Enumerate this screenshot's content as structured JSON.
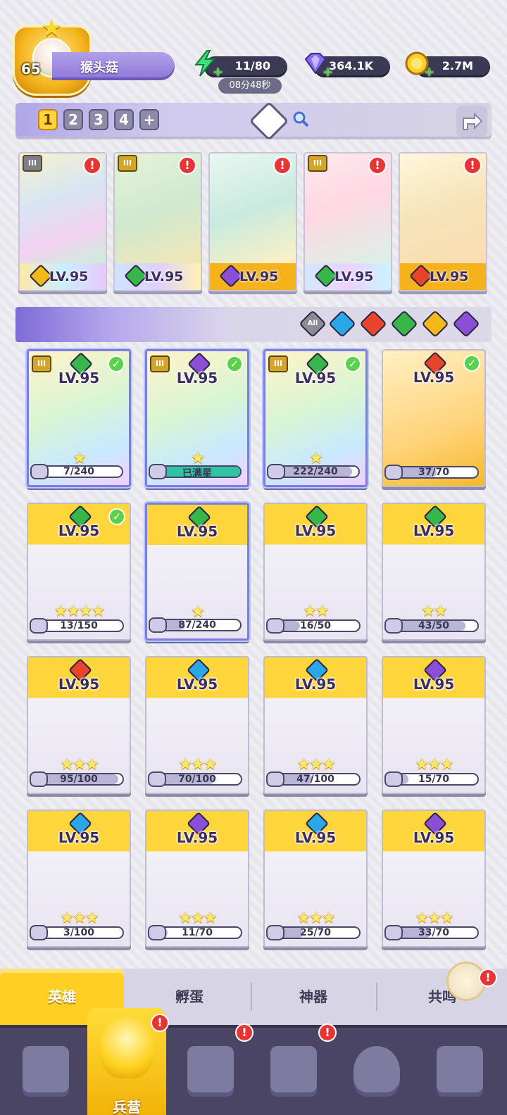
{
  "player": {
    "level": "65",
    "name": "猴头菇"
  },
  "resources": {
    "energy": "11/80",
    "energy_timer": "08分48秒",
    "gems": "364.1K",
    "coins": "2.7M"
  },
  "team_tabs": [
    "1",
    "2",
    "3",
    "4",
    "+"
  ],
  "team_add_label": "+",
  "team": [
    {
      "level": "LV.95",
      "element": "light",
      "tier": "III",
      "alert": "!"
    },
    {
      "level": "LV.95",
      "element": "nature",
      "tier": "III",
      "alert": "!"
    },
    {
      "level": "LV.95",
      "element": "dark",
      "alert": "!"
    },
    {
      "level": "LV.95",
      "element": "nature",
      "tier": "III",
      "alert": "!"
    },
    {
      "level": "LV.95",
      "element": "fire",
      "alert": "!"
    }
  ],
  "filters": {
    "all_label": "All",
    "elements": [
      "water",
      "fire",
      "nature",
      "light",
      "dark"
    ]
  },
  "heroes": [
    {
      "level": "LV.95",
      "element": "nature",
      "tier": "III",
      "check": "✓",
      "stars": "★",
      "progress_label": "7/240",
      "progress": 0.03
    },
    {
      "level": "LV.95",
      "element": "dark",
      "tier": "III",
      "check": "✓",
      "stars": "★",
      "progress_label": "已满星",
      "progress": 1
    },
    {
      "level": "LV.95",
      "element": "nature",
      "tier": "III",
      "check": "✓",
      "stars": "★",
      "progress_label": "222/240",
      "progress": 0.93
    },
    {
      "level": "LV.95",
      "element": "fire",
      "check": "✓",
      "stars": "",
      "progress_label": "37/70",
      "progress": 0.53
    },
    {
      "level": "LV.95",
      "element": "nature",
      "check": "✓",
      "stars": "★★★★",
      "progress_label": "13/150",
      "progress": 0.09
    },
    {
      "level": "LV.95",
      "element": "nature",
      "stars": "★",
      "progress_label": "87/240",
      "progress": 0.36
    },
    {
      "level": "LV.95",
      "element": "nature",
      "stars": "★★",
      "progress_label": "16/50",
      "progress": 0.32
    },
    {
      "level": "LV.95",
      "element": "nature",
      "stars": "★★",
      "progress_label": "43/50",
      "progress": 0.86
    },
    {
      "level": "LV.95",
      "element": "fire",
      "stars": "★★★",
      "progress_label": "95/100",
      "progress": 0.95
    },
    {
      "level": "LV.95",
      "element": "water",
      "stars": "★★★",
      "progress_label": "70/100",
      "progress": 0.7
    },
    {
      "level": "LV.95",
      "element": "water",
      "stars": "★★★",
      "progress_label": "47/100",
      "progress": 0.47
    },
    {
      "level": "LV.95",
      "element": "dark",
      "stars": "★★★",
      "progress_label": "15/70",
      "progress": 0.21
    },
    {
      "level": "LV.95",
      "element": "water",
      "stars": "★★★",
      "progress_label": "3/100",
      "progress": 0.03
    },
    {
      "level": "LV.95",
      "element": "dark",
      "stars": "★★★",
      "progress_label": "11/70",
      "progress": 0.16
    },
    {
      "level": "LV.95",
      "element": "water",
      "stars": "★★★",
      "progress_label": "25/70",
      "progress": 0.36
    },
    {
      "level": "LV.95",
      "element": "dark",
      "stars": "★★★",
      "progress_label": "33/70",
      "progress": 0.47
    }
  ],
  "sub_tabs": [
    "英雄",
    "孵蛋",
    "神器",
    "共鸣"
  ],
  "nav": {
    "active_label": "兵营"
  },
  "alerts": {
    "resonance": "!",
    "nav_barracks": "!",
    "nav_map": "!",
    "nav_castle": "!"
  },
  "colors": {
    "water": "#2aa7e8",
    "fire": "#e8432b",
    "nature": "#37b74a",
    "light": "#f3b81a",
    "dark": "#8a4fd6",
    "accent": "#ffcf24"
  }
}
